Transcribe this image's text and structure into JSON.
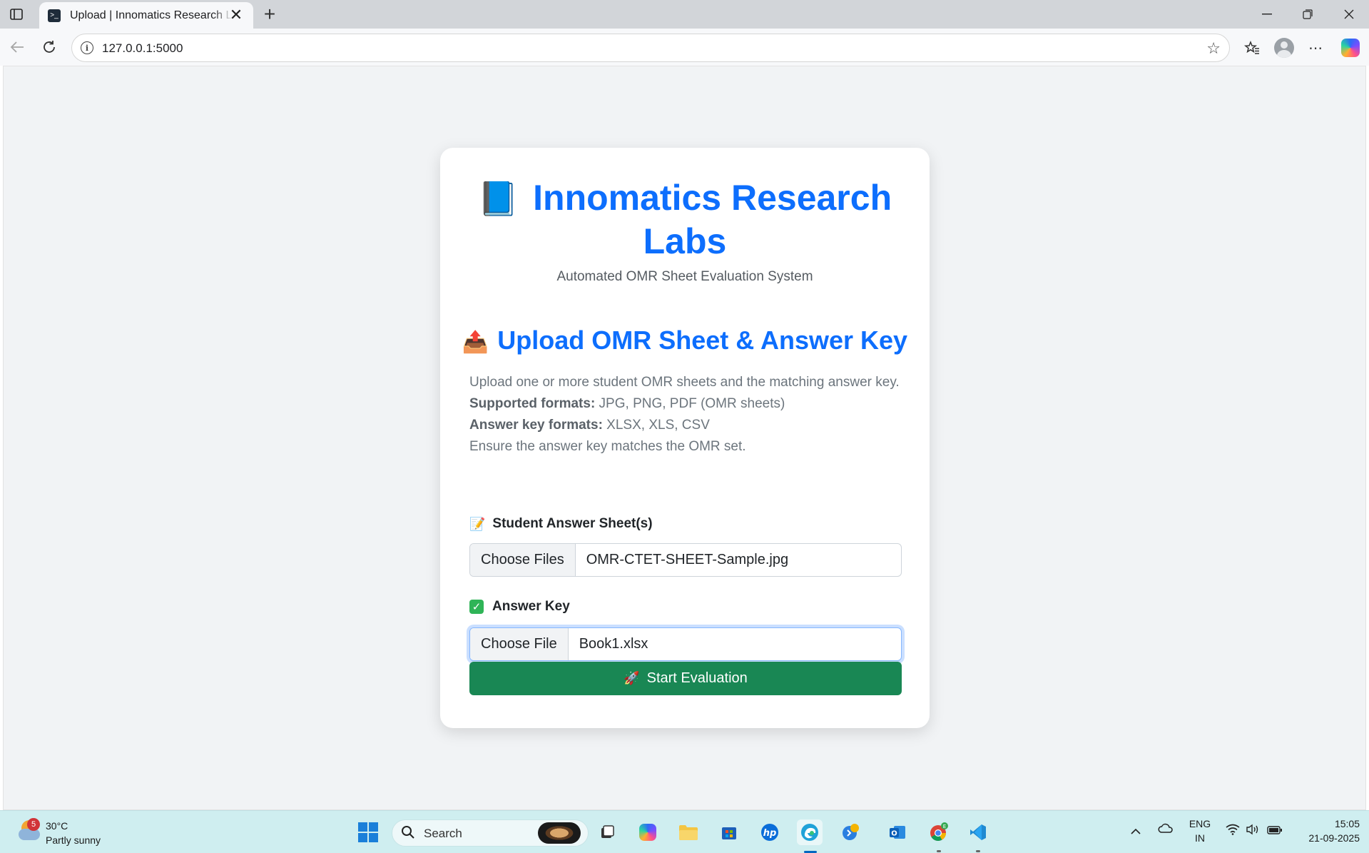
{
  "browser": {
    "tab_title": "Upload | Innomatics Research Labs",
    "tab_close": "✕",
    "new_tab": "+",
    "url": "127.0.0.1:5000"
  },
  "page": {
    "brand_emoji": "📘",
    "brand_title": "Innomatics Research Labs",
    "subtitle": "Automated OMR Sheet Evaluation System",
    "upload_emoji": "📤",
    "upload_title": "Upload OMR Sheet & Answer Key",
    "description": {
      "intro": "Upload one or more student OMR sheets and the matching answer key.",
      "supported_label": "Supported formats:",
      "supported_value": " JPG, PNG, PDF (OMR sheets)",
      "answer_label": "Answer key formats:",
      "answer_value": " XLSX, XLS, CSV",
      "note": "Ensure the answer key matches the OMR set."
    },
    "student_field": {
      "icon": "📝",
      "label": "Student Answer Sheet(s)",
      "button": "Choose Files",
      "filename": "OMR-CTET-SHEET-Sample.jpg"
    },
    "answer_field": {
      "icon": "✓",
      "label": "Answer Key",
      "button": "Choose File",
      "filename": "Book1.xlsx"
    },
    "submit": {
      "icon": "🚀",
      "label": "Start Evaluation"
    }
  },
  "taskbar": {
    "weather_badge": "5",
    "weather_temp": "30°C",
    "weather_desc": "Partly sunny",
    "search_label": "Search",
    "lang_top": "ENG",
    "lang_bottom": "IN",
    "time": "15:05",
    "date": "21-09-2025"
  },
  "colors": {
    "accent": "#0d6efd",
    "submit": "#198754"
  }
}
